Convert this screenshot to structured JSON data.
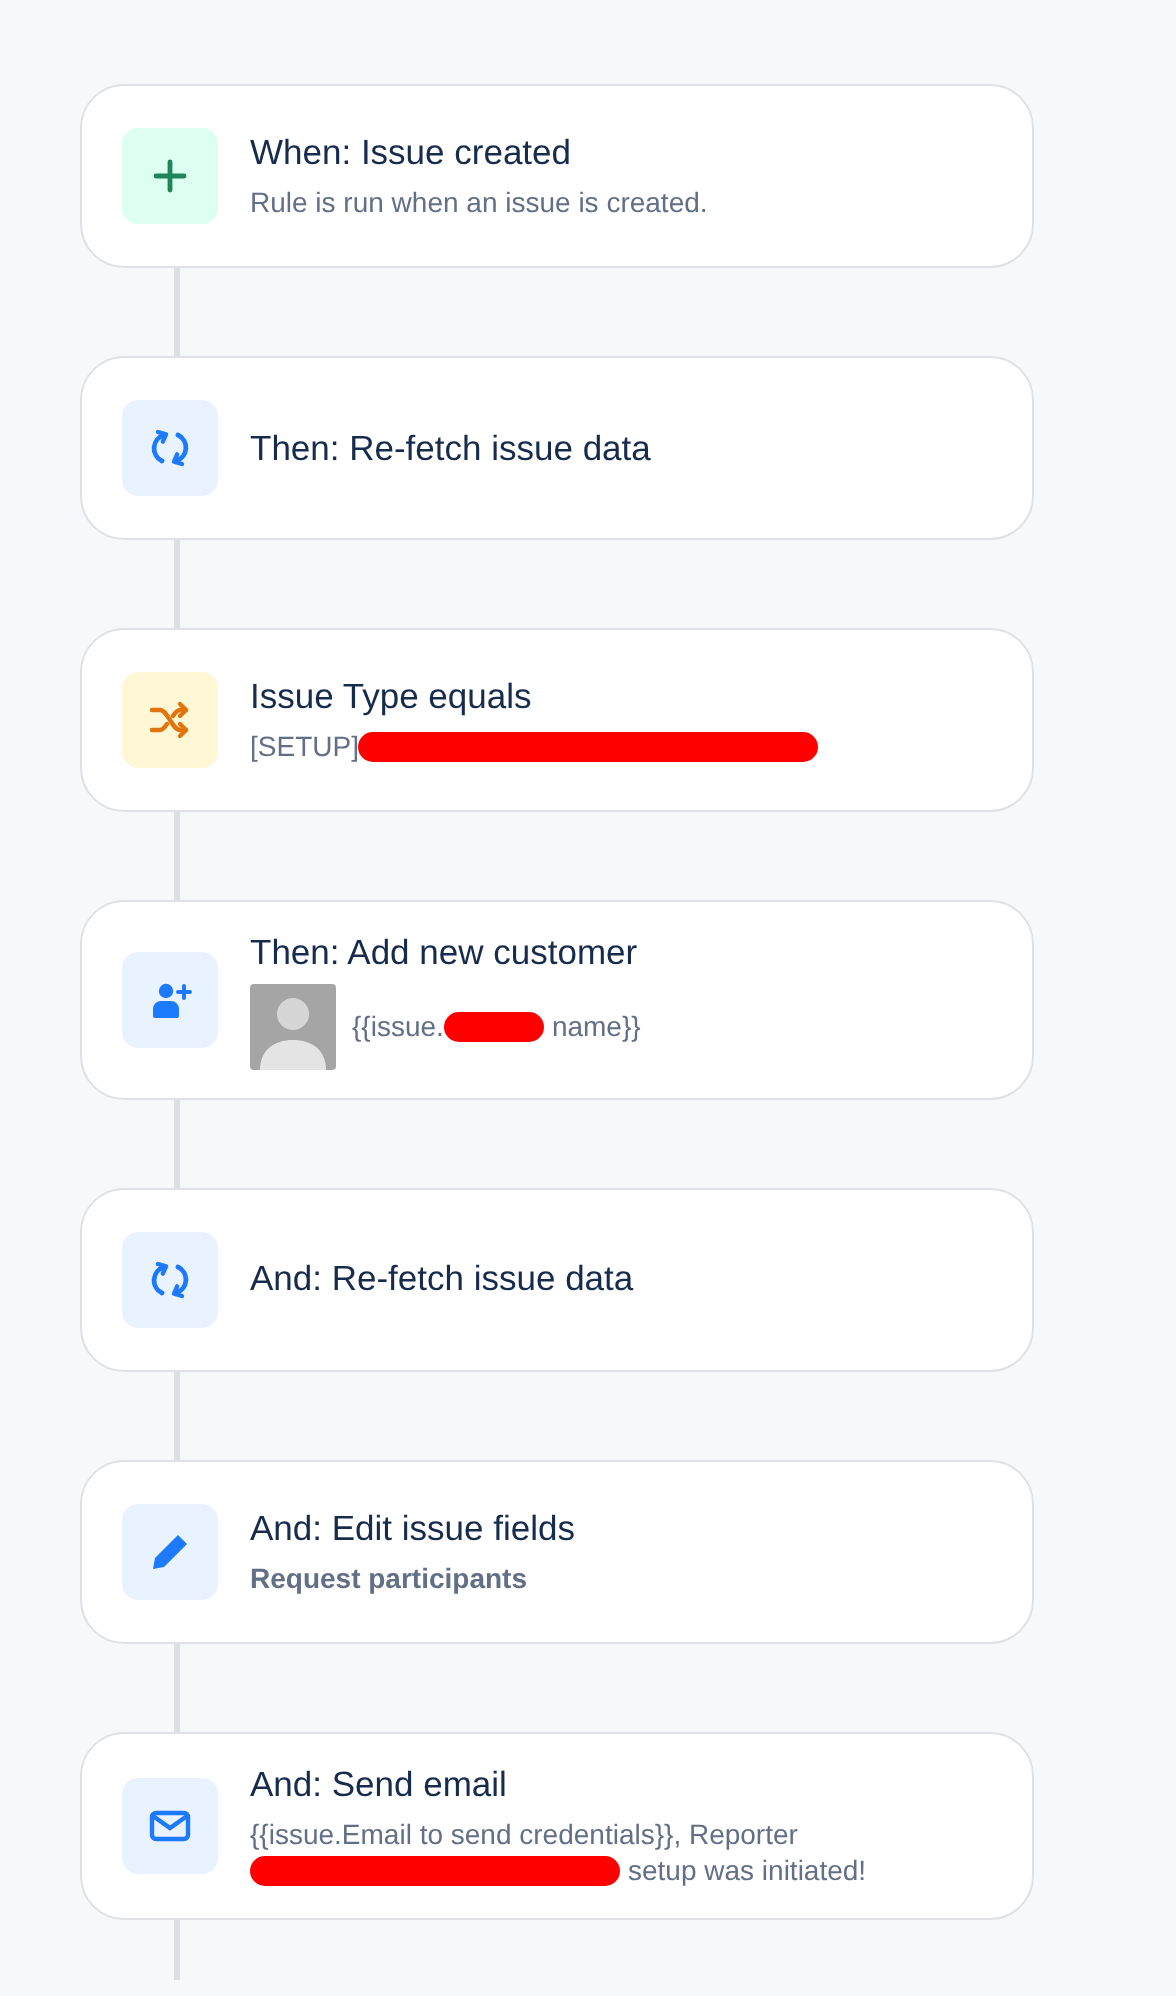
{
  "steps": [
    {
      "kind": "trigger",
      "title": "When: Issue created",
      "detail": [
        [
          {
            "kind": "text",
            "text": "Rule is run when an issue is created."
          }
        ]
      ]
    },
    {
      "kind": "refetch",
      "title": "Then: Re-fetch issue data"
    },
    {
      "kind": "condition",
      "title": "Issue Type equals",
      "detail": [
        [
          {
            "kind": "text",
            "text": "[SETUP]"
          },
          {
            "kind": "redaction"
          }
        ]
      ]
    },
    {
      "kind": "customer",
      "title": "Then: Add new customer",
      "avatar": true,
      "detail": [
        [
          {
            "kind": "text",
            "text": "{{issue."
          },
          {
            "kind": "redaction"
          },
          {
            "kind": "text",
            "text": "name}}"
          }
        ]
      ]
    },
    {
      "kind": "refetch",
      "title": "And: Re-fetch issue data"
    },
    {
      "kind": "edit",
      "title": "And: Edit issue fields",
      "detail": [
        [
          {
            "kind": "strong",
            "text": "Request participants"
          }
        ]
      ]
    },
    {
      "kind": "email",
      "title": "And: Send email",
      "detail": [
        [
          {
            "kind": "text",
            "text": "{{issue.Email to send credentials}}, Reporter"
          }
        ],
        [
          {
            "kind": "redaction"
          },
          {
            "kind": "text",
            "text": "setup was initiated!"
          }
        ]
      ]
    }
  ],
  "trailing_connector": true
}
